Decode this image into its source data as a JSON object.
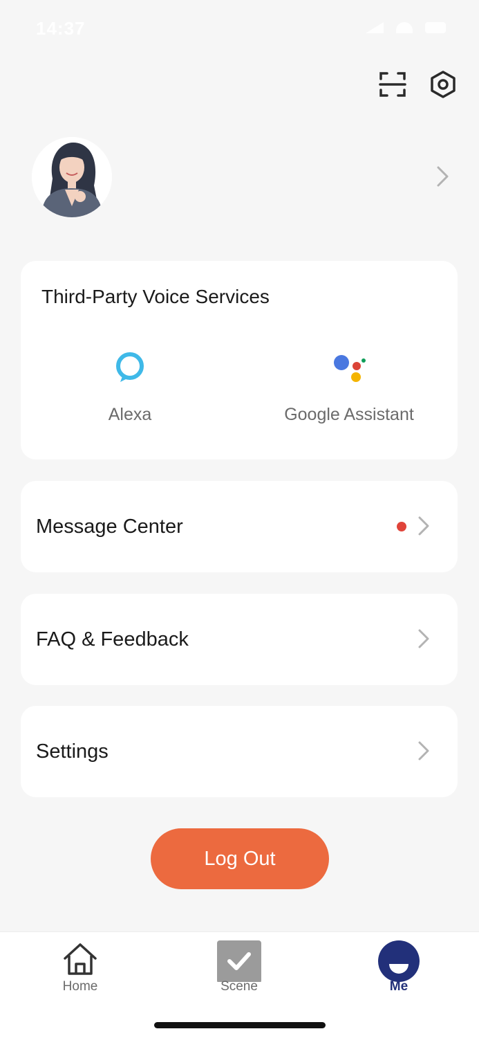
{
  "status_bar": {
    "time": "14:37"
  },
  "header": {
    "scan_icon": "scan-icon",
    "settings_icon": "gear-icon"
  },
  "profile": {
    "avatar_icon": "avatar",
    "chevron_icon": "chevron-right-icon"
  },
  "voice_services": {
    "title": "Third-Party Voice Services",
    "items": [
      {
        "label": "Alexa",
        "icon": "alexa-icon",
        "color": "#3fb9e8"
      },
      {
        "label": "Google Assistant",
        "icon": "google-assistant-icon"
      }
    ]
  },
  "menu": [
    {
      "label": "Message Center",
      "has_badge": true,
      "badge_color": "#e0443a"
    },
    {
      "label": "FAQ & Feedback",
      "has_badge": false
    },
    {
      "label": "Settings",
      "has_badge": false
    }
  ],
  "logout": {
    "label": "Log Out",
    "color": "#ec6a3f"
  },
  "tabs": [
    {
      "label": "Home",
      "icon": "home-icon"
    },
    {
      "label": "Scene",
      "icon": "scene-icon"
    },
    {
      "label": "Me",
      "icon": "me-icon",
      "active": true,
      "color": "#22307a"
    }
  ]
}
